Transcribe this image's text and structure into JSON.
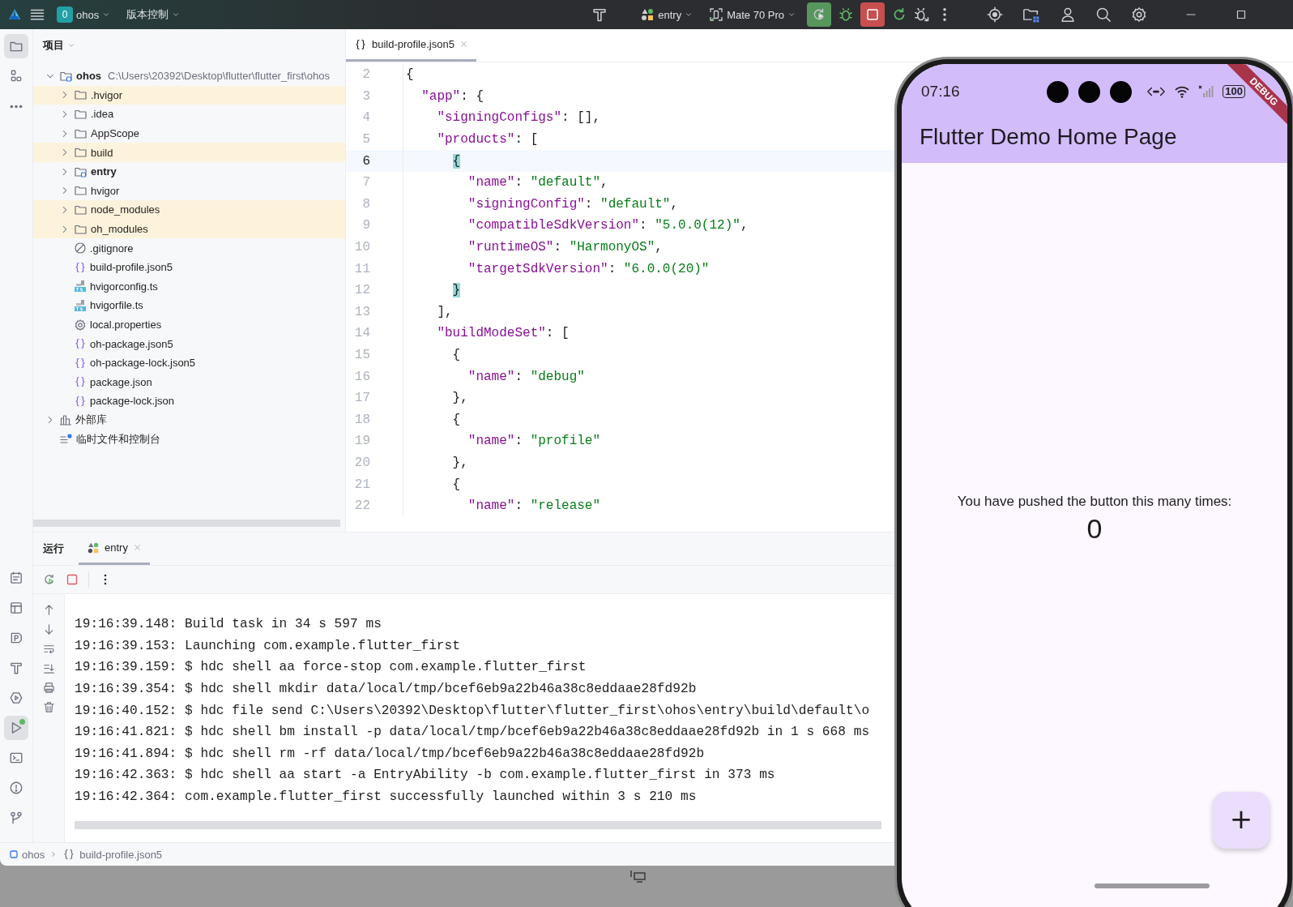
{
  "title_bar": {
    "project_badge": "0",
    "project": "ohos",
    "vcs": "版本控制",
    "run_config": "entry",
    "device": "Mate 70 Pro"
  },
  "activity_bar": {
    "top": [
      {
        "kind": "project",
        "selected": true,
        "badge": false
      },
      {
        "kind": "structure",
        "selected": false,
        "badge": false
      },
      {
        "kind": "more",
        "selected": false,
        "badge": false
      }
    ],
    "bottom": [
      {
        "kind": "notes",
        "selected": false,
        "badge": false
      },
      {
        "kind": "layout",
        "selected": false,
        "badge": false
      },
      {
        "kind": "profiler",
        "selected": false,
        "badge": false
      },
      {
        "kind": "build",
        "selected": false,
        "badge": false
      },
      {
        "kind": "services",
        "selected": false,
        "badge": false
      },
      {
        "kind": "run",
        "selected": true,
        "badge": true
      },
      {
        "kind": "terminal",
        "selected": false,
        "badge": false
      },
      {
        "kind": "problems",
        "selected": false,
        "badge": false
      },
      {
        "kind": "git",
        "selected": false,
        "badge": false
      }
    ]
  },
  "project_panel": {
    "title": "项目",
    "tree": [
      {
        "name": "ohos",
        "path": "C:\\Users\\20392\\Desktop\\flutter\\flutter_first\\ohos",
        "kind": "module",
        "expanded": true,
        "children": [
          {
            "name": ".hvigor",
            "kind": "folder",
            "expanded": false,
            "excluded": true
          },
          {
            "name": ".idea",
            "kind": "folder",
            "expanded": false,
            "excluded": false
          },
          {
            "name": "AppScope",
            "kind": "folder",
            "expanded": false,
            "excluded": false
          },
          {
            "name": "build",
            "kind": "folder",
            "expanded": false,
            "excluded": true
          },
          {
            "name": "entry",
            "kind": "module",
            "expanded": false,
            "excluded": false
          },
          {
            "name": "hvigor",
            "kind": "folder",
            "expanded": false,
            "excluded": false
          },
          {
            "name": "node_modules",
            "kind": "folder",
            "expanded": false,
            "excluded": true
          },
          {
            "name": "oh_modules",
            "kind": "folder",
            "expanded": false,
            "excluded": true
          },
          {
            "name": ".gitignore",
            "kind": "ignore",
            "excluded": false
          },
          {
            "name": "build-profile.json5",
            "kind": "json",
            "excluded": false
          },
          {
            "name": "hvigorconfig.ts",
            "kind": "ts",
            "excluded": false
          },
          {
            "name": "hvigorfile.ts",
            "kind": "ts",
            "excluded": false
          },
          {
            "name": "local.properties",
            "kind": "settings",
            "excluded": false
          },
          {
            "name": "oh-package.json5",
            "kind": "json",
            "excluded": false
          },
          {
            "name": "oh-package-lock.json5",
            "kind": "json",
            "excluded": false
          },
          {
            "name": "package.json",
            "kind": "json",
            "excluded": false
          },
          {
            "name": "package-lock.json",
            "kind": "json",
            "excluded": false
          }
        ]
      },
      {
        "name": "外部库",
        "kind": "library",
        "expanded": false
      },
      {
        "name": "临时文件和控制台",
        "kind": "scratch"
      }
    ]
  },
  "editor": {
    "tabs": [
      {
        "label": "build-profile.json5",
        "selected": true
      }
    ],
    "lines": [
      {
        "number": "2",
        "current": false,
        "tokens": [
          {
            "kind": "punct",
            "text": "{"
          }
        ]
      },
      {
        "number": "3",
        "current": false,
        "tokens": [
          {
            "kind": "key",
            "text": "  \"app\""
          },
          {
            "kind": "punct",
            "text": ": {"
          }
        ]
      },
      {
        "number": "4",
        "current": false,
        "tokens": [
          {
            "kind": "key",
            "text": "    \"signingConfigs\""
          },
          {
            "kind": "punct",
            "text": ": [],"
          }
        ]
      },
      {
        "number": "5",
        "current": false,
        "tokens": [
          {
            "kind": "key",
            "text": "    \"products\""
          },
          {
            "kind": "punct",
            "text": ": ["
          }
        ]
      },
      {
        "number": "6",
        "current": true,
        "tokens": [
          {
            "kind": "match",
            "text": "      {"
          }
        ]
      },
      {
        "number": "7",
        "current": false,
        "tokens": [
          {
            "kind": "key",
            "text": "        \"name\""
          },
          {
            "kind": "punct",
            "text": ": "
          },
          {
            "kind": "string",
            "text": "\"default\""
          },
          {
            "kind": "punct",
            "text": ","
          }
        ]
      },
      {
        "number": "8",
        "current": false,
        "tokens": [
          {
            "kind": "key",
            "text": "        \"signingConfig\""
          },
          {
            "kind": "punct",
            "text": ": "
          },
          {
            "kind": "string",
            "text": "\"default\""
          },
          {
            "kind": "punct",
            "text": ","
          }
        ]
      },
      {
        "number": "9",
        "current": false,
        "tokens": [
          {
            "kind": "key",
            "text": "        \"compatibleSdkVersion\""
          },
          {
            "kind": "punct",
            "text": ": "
          },
          {
            "kind": "string",
            "text": "\"5.0.0(12)\""
          },
          {
            "kind": "punct",
            "text": ","
          }
        ]
      },
      {
        "number": "10",
        "current": false,
        "tokens": [
          {
            "kind": "key",
            "text": "        \"runtimeOS\""
          },
          {
            "kind": "punct",
            "text": ": "
          },
          {
            "kind": "string",
            "text": "\"HarmonyOS\""
          },
          {
            "kind": "punct",
            "text": ","
          }
        ]
      },
      {
        "number": "11",
        "current": false,
        "tokens": [
          {
            "kind": "key",
            "text": "        \"targetSdkVersion\""
          },
          {
            "kind": "punct",
            "text": ": "
          },
          {
            "kind": "string",
            "text": "\"6.0.0(20)\""
          }
        ]
      },
      {
        "number": "12",
        "current": false,
        "tokens": [
          {
            "kind": "match",
            "text": "      }"
          }
        ]
      },
      {
        "number": "13",
        "current": false,
        "tokens": [
          {
            "kind": "punct",
            "text": "    ],"
          }
        ]
      },
      {
        "number": "14",
        "current": false,
        "tokens": [
          {
            "kind": "key",
            "text": "    \"buildModeSet\""
          },
          {
            "kind": "punct",
            "text": ": ["
          }
        ]
      },
      {
        "number": "15",
        "current": false,
        "tokens": [
          {
            "kind": "punct",
            "text": "      {"
          }
        ]
      },
      {
        "number": "16",
        "current": false,
        "tokens": [
          {
            "kind": "key",
            "text": "        \"name\""
          },
          {
            "kind": "punct",
            "text": ": "
          },
          {
            "kind": "string",
            "text": "\"debug\""
          }
        ]
      },
      {
        "number": "17",
        "current": false,
        "tokens": [
          {
            "kind": "punct",
            "text": "      },"
          }
        ]
      },
      {
        "number": "18",
        "current": false,
        "tokens": [
          {
            "kind": "punct",
            "text": "      {"
          }
        ]
      },
      {
        "number": "19",
        "current": false,
        "tokens": [
          {
            "kind": "key",
            "text": "        \"name\""
          },
          {
            "kind": "punct",
            "text": ": "
          },
          {
            "kind": "string",
            "text": "\"profile\""
          }
        ]
      },
      {
        "number": "20",
        "current": false,
        "tokens": [
          {
            "kind": "punct",
            "text": "      },"
          }
        ]
      },
      {
        "number": "21",
        "current": false,
        "tokens": [
          {
            "kind": "punct",
            "text": "      {"
          }
        ]
      },
      {
        "number": "22",
        "current": false,
        "tokens": [
          {
            "kind": "key",
            "text": "        \"name\""
          },
          {
            "kind": "punct",
            "text": ": "
          },
          {
            "kind": "string",
            "text": "\"release\""
          }
        ]
      }
    ]
  },
  "run_panel": {
    "title": "运行",
    "tabs": [
      {
        "label": "entry",
        "selected": true
      }
    ],
    "console": [
      "19:16:39.148: Build task in 34 s 597 ms",
      "19:16:39.153: Launching com.example.flutter_first",
      "19:16:39.159: $ hdc shell aa force-stop com.example.flutter_first",
      "19:16:39.354: $ hdc shell mkdir data/local/tmp/bcef6eb9a22b46a38c8eddaae28fd92b",
      "19:16:40.152: $ hdc file send C:\\Users\\20392\\Desktop\\flutter\\flutter_first\\ohos\\entry\\build\\default\\o",
      "19:16:41.821: $ hdc shell bm install -p data/local/tmp/bcef6eb9a22b46a38c8eddaae28fd92b in 1 s 668 ms",
      "19:16:41.894: $ hdc shell rm -rf data/local/tmp/bcef6eb9a22b46a38c8eddaae28fd92b",
      "19:16:42.363: $ hdc shell aa start -a EntryAbility -b com.example.flutter_first in 373 ms",
      "19:16:42.364: com.example.flutter_first successfully launched within 3 s 210 ms"
    ]
  },
  "breadcrumb": [
    "ohos",
    "build-profile.json5"
  ],
  "phone": {
    "time": "07:16",
    "battery": "100",
    "ribbon": "DEBUG",
    "app_title": "Flutter Demo Home Page",
    "message": "You have pushed the button this many times:",
    "counter": "0",
    "fab": "+"
  }
}
